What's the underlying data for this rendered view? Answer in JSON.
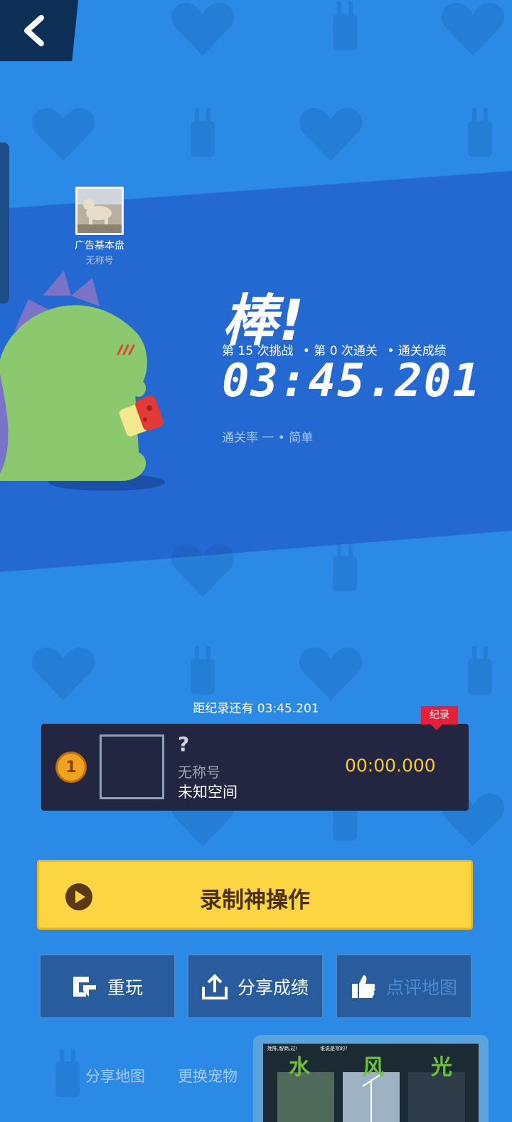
{
  "colors": {
    "background": "#2a8ae6",
    "band": "#2468d2",
    "card": "#232640",
    "gold": "#f7c92a",
    "button_yellow": "#fbd542",
    "record_red": "#e5213a"
  },
  "nav": {
    "back_icon": "chevron-left-icon"
  },
  "author": {
    "name": "广告基本盘",
    "subtitle": "无称号"
  },
  "result": {
    "title": "棒!",
    "attempt_text": "第 15 次挑战",
    "clears_text": "• 第 0 次通关",
    "score_text": "• 通关成绩",
    "time": "03:45.201",
    "pass_rate_text": "通关率 一 • 简单"
  },
  "record": {
    "gap_text": "距纪录还有 03:45.201",
    "tag": "纪录",
    "rank": "1",
    "player_name": "?",
    "player_title": "无称号",
    "player_space": "未知空间",
    "time": "00:00.000"
  },
  "actions": {
    "record_label": "录制神操作",
    "replay_label": "重玩",
    "share_score_label": "分享成绩",
    "review_map_label": "点评地图",
    "share_map_label": "分享地图",
    "change_pet_label": "更换宠物"
  },
  "ad": {
    "line1": "姓陈,智商,过!",
    "line2": "谁说是写的?",
    "word1": "水",
    "word2": "风",
    "word3": "光"
  }
}
